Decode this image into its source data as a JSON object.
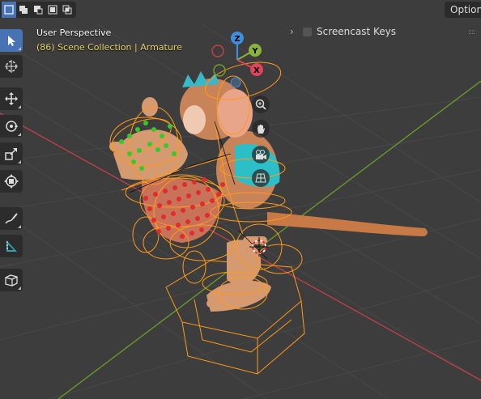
{
  "header": {
    "select_modes": [
      {
        "icon": "select-new-icon",
        "active": true
      },
      {
        "icon": "select-extend-icon",
        "active": false
      },
      {
        "icon": "select-subtract-icon",
        "active": false
      },
      {
        "icon": "select-invert-icon",
        "active": false
      },
      {
        "icon": "select-intersect-icon",
        "active": false
      }
    ],
    "options_label": "Options"
  },
  "viewport": {
    "view_name": "User Perspective",
    "collection_info": "(86) Scene Collection | Armature"
  },
  "overlays": {
    "screencast_keys_label": "Screencast Keys",
    "screencast_keys_enabled": false
  },
  "gizmo": {
    "axes": [
      "Z",
      "Y",
      "X"
    ],
    "colors": {
      "x": "#e0435a",
      "y": "#8ab43c",
      "z": "#3f8fe0"
    }
  },
  "toolbar": {
    "tools": [
      {
        "name": "select-box",
        "icon": "cursor-arrow-icon",
        "active": true
      },
      {
        "name": "cursor",
        "icon": "3d-cursor-icon",
        "active": false
      },
      {
        "name": "move",
        "icon": "move-icon",
        "active": false
      },
      {
        "name": "rotate",
        "icon": "rotate-icon",
        "active": false
      },
      {
        "name": "scale",
        "icon": "scale-icon",
        "active": false
      },
      {
        "name": "transform",
        "icon": "transform-icon",
        "active": false
      },
      {
        "name": "annotate",
        "icon": "annotate-pen-icon",
        "active": false
      },
      {
        "name": "measure",
        "icon": "measure-ruler-icon",
        "active": false
      },
      {
        "name": "add-cube",
        "icon": "add-cube-icon",
        "active": false
      }
    ]
  },
  "nav_buttons": [
    "zoom-icon",
    "hand-pan-icon",
    "camera-icon",
    "grid-ortho-icon"
  ],
  "colors": {
    "background": "#3d3d3d",
    "grid_x_axis": "#c0404a",
    "grid_y_axis": "#6c9d28",
    "armature_selected": "#ff9a1a",
    "bone_joint_red": "#e02c2c",
    "bone_joint_green": "#37c82c",
    "active_tool": "#4772b3",
    "collection_text": "#e8d46b"
  }
}
